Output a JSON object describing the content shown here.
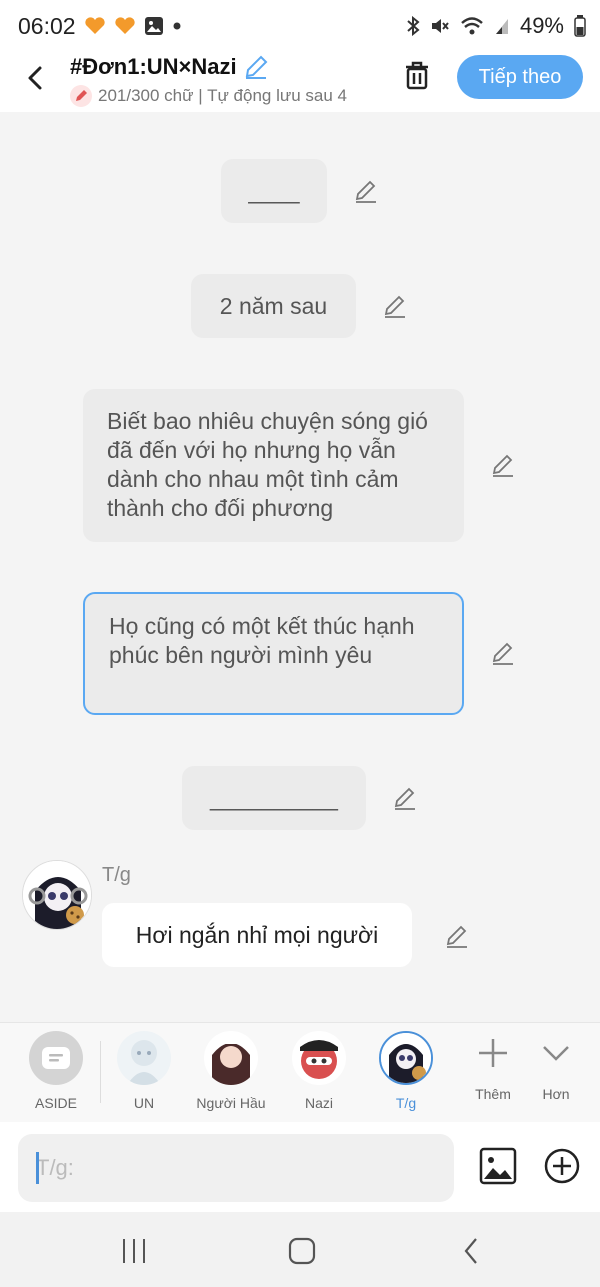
{
  "status": {
    "time": "06:02",
    "battery": "49%",
    "icons_left": [
      "heart-badge-icon",
      "heart-badge-icon",
      "gallery-icon",
      "dot-icon"
    ],
    "icons_right": [
      "bluetooth-icon",
      "mute-icon",
      "wifi-icon",
      "signal-icon",
      "battery-icon"
    ]
  },
  "header": {
    "title": "#Đơn1:UN×Nazi",
    "subtitle": "201/300 chữ | Tự động lưu sau 4",
    "next_label": "Tiếp theo"
  },
  "messages": [
    {
      "type": "narration",
      "text": "____"
    },
    {
      "type": "narration",
      "text": "2 năm sau"
    },
    {
      "type": "narration",
      "text": "Biết bao nhiêu chuyện sóng gió đã đến với họ nhưng họ vẫn dành cho nhau một tình cảm thành cho đối phương"
    },
    {
      "type": "narration",
      "text": "Họ cũng có một kết thúc hạnh phúc bên người mình yêu",
      "selected": true
    },
    {
      "type": "narration",
      "text": "__________"
    },
    {
      "type": "dialogue",
      "speaker": "T/g",
      "text": "Hơi ngắn nhỉ mọi người"
    }
  ],
  "characters": [
    {
      "name": "ASIDE",
      "kind": "aside"
    },
    {
      "name": "UN",
      "kind": "char"
    },
    {
      "name": "Người Hầu",
      "kind": "char"
    },
    {
      "name": "Nazi",
      "kind": "char"
    },
    {
      "name": "T/g",
      "kind": "char",
      "active": true
    }
  ],
  "actions": {
    "add_label": "Thêm",
    "more_label": "Hơn"
  },
  "input": {
    "placeholder": "T/g:"
  },
  "colors": {
    "accent": "#5aa8f2",
    "bubble": "#ebebeb",
    "background": "#f4f4f4"
  }
}
